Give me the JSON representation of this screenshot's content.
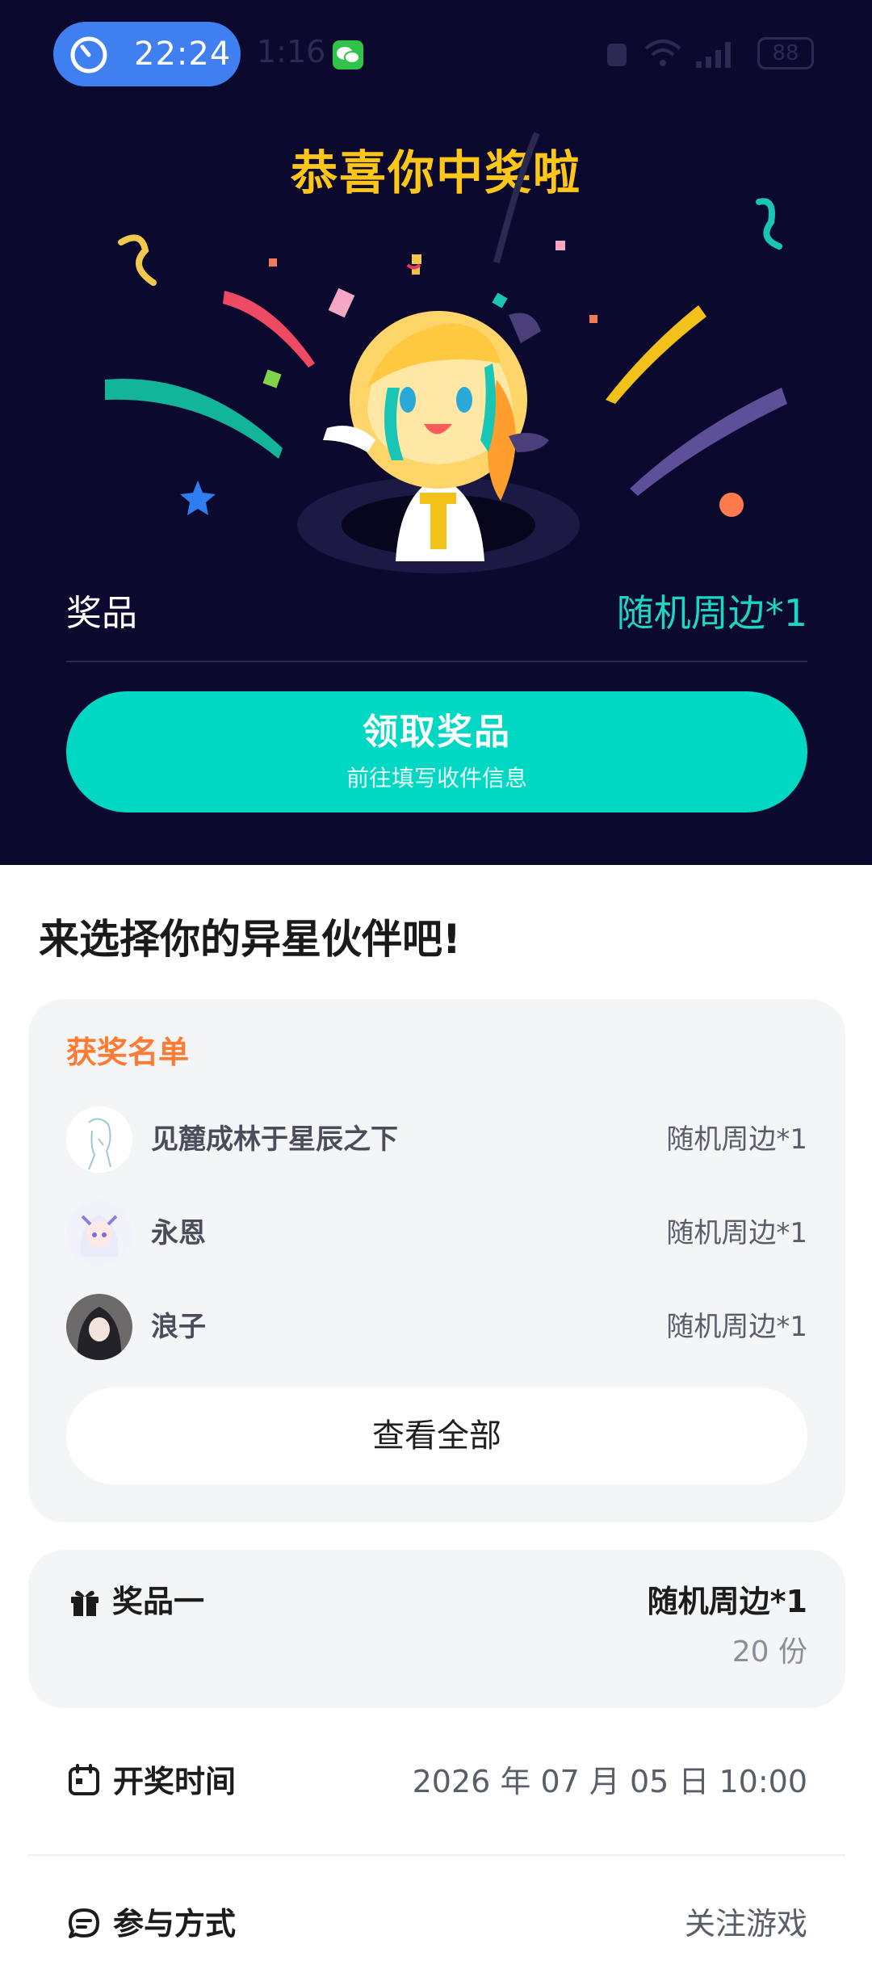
{
  "status_bar": {
    "timer": "22:24",
    "time": "1:16",
    "battery": "88"
  },
  "hero": {
    "title": "恭喜你中奖啦",
    "prize_label": "奖品",
    "prize_value": "随机周边*1",
    "claim_button": {
      "title": "领取奖品",
      "subtitle": "前往填写收件信息"
    }
  },
  "section_title": "来选择你的异星伙伴吧!",
  "winners": {
    "heading": "获奖名单",
    "list": [
      {
        "name": "见麓成林于星辰之下",
        "prize": "随机周边*1"
      },
      {
        "name": "永恩",
        "prize": "随机周边*1"
      },
      {
        "name": "浪子",
        "prize": "随机周边*1"
      }
    ],
    "view_all": "查看全部"
  },
  "prize_one": {
    "label": "奖品一",
    "value": "随机周边*1",
    "count": "20 份"
  },
  "draw_time": {
    "label": "开奖时间",
    "value": "2026 年 07 月 05 日 10:00"
  },
  "participation": {
    "label": "参与方式",
    "value": "关注游戏"
  },
  "colors": {
    "hero_bg": "#0b0a2e",
    "accent_teal": "#00d8c4",
    "title_gold": "#ffc61a",
    "winners_heading": "#ff7a33"
  }
}
